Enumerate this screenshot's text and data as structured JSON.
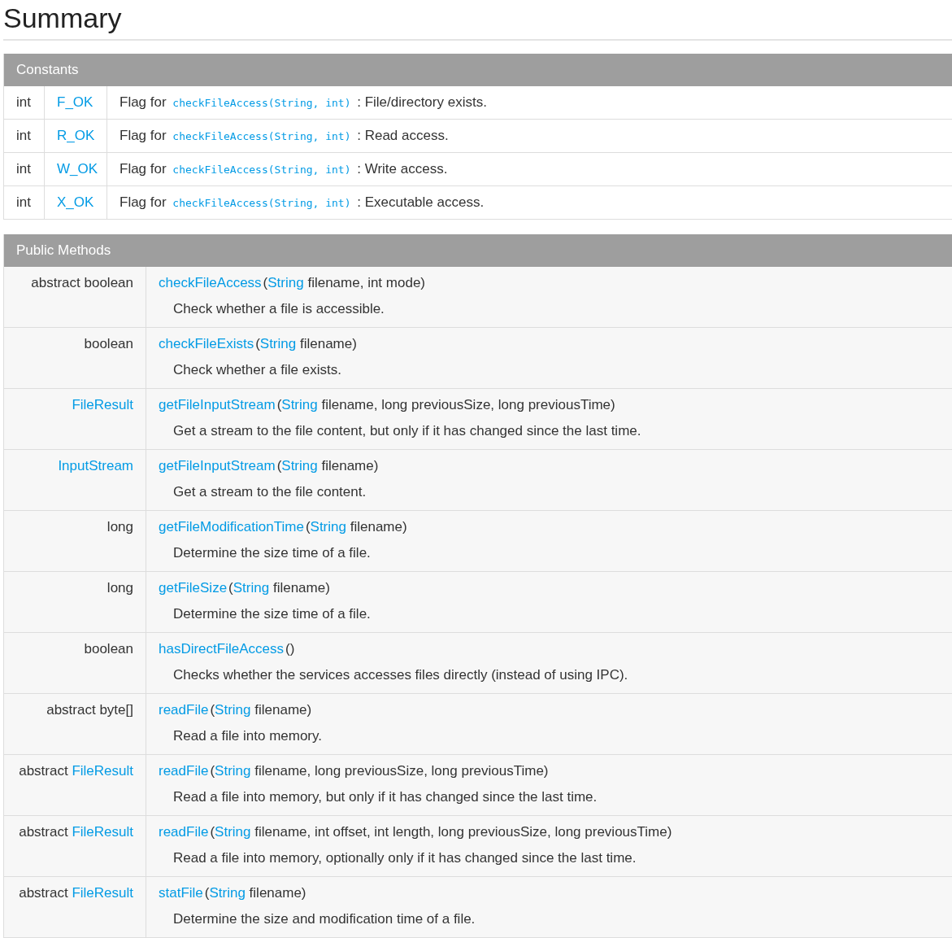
{
  "title": "Summary",
  "constants": {
    "heading": "Constants",
    "rows": [
      {
        "type": "int",
        "name": "F_OK",
        "prefix": "Flag for",
        "code": "checkFileAccess(String, int)",
        "suffix": ": File/directory exists."
      },
      {
        "type": "int",
        "name": "R_OK",
        "prefix": "Flag for",
        "code": "checkFileAccess(String, int)",
        "suffix": ": Read access."
      },
      {
        "type": "int",
        "name": "W_OK",
        "prefix": "Flag for",
        "code": "checkFileAccess(String, int)",
        "suffix": ": Write access."
      },
      {
        "type": "int",
        "name": "X_OK",
        "prefix": "Flag for",
        "code": "checkFileAccess(String, int)",
        "suffix": ": Executable access."
      }
    ]
  },
  "methods": {
    "heading": "Public Methods",
    "rows": [
      {
        "modifier": "abstract",
        "type": "boolean",
        "type_link": false,
        "name": "checkFileAccess",
        "params": [
          {
            "text": "(",
            "link": false
          },
          {
            "text": "String",
            "link": true
          },
          {
            "text": " filename, int mode)",
            "link": false
          }
        ],
        "description": "Check whether a file is accessible."
      },
      {
        "type": "boolean",
        "type_link": false,
        "name": "checkFileExists",
        "params": [
          {
            "text": "(",
            "link": false
          },
          {
            "text": "String",
            "link": true
          },
          {
            "text": " filename)",
            "link": false
          }
        ],
        "description": "Check whether a file exists."
      },
      {
        "type": "FileResult",
        "type_link": true,
        "name": "getFileInputStream",
        "params": [
          {
            "text": "(",
            "link": false
          },
          {
            "text": "String",
            "link": true
          },
          {
            "text": " filename, long previousSize, long previousTime)",
            "link": false
          }
        ],
        "description": "Get a stream to the file content, but only if it has changed since the last time."
      },
      {
        "type": "InputStream",
        "type_link": true,
        "name": "getFileInputStream",
        "params": [
          {
            "text": "(",
            "link": false
          },
          {
            "text": "String",
            "link": true
          },
          {
            "text": " filename)",
            "link": false
          }
        ],
        "description": "Get a stream to the file content."
      },
      {
        "type": "long",
        "type_link": false,
        "name": "getFileModificationTime",
        "params": [
          {
            "text": "(",
            "link": false
          },
          {
            "text": "String",
            "link": true
          },
          {
            "text": " filename)",
            "link": false
          }
        ],
        "description": "Determine the size time of a file."
      },
      {
        "type": "long",
        "type_link": false,
        "name": "getFileSize",
        "params": [
          {
            "text": "(",
            "link": false
          },
          {
            "text": "String",
            "link": true
          },
          {
            "text": " filename)",
            "link": false
          }
        ],
        "description": "Determine the size time of a file."
      },
      {
        "type": "boolean",
        "type_link": false,
        "name": "hasDirectFileAccess",
        "params": [
          {
            "text": "()",
            "link": false
          }
        ],
        "description": "Checks whether the services accesses files directly (instead of using IPC)."
      },
      {
        "modifier": "abstract",
        "type": "byte[]",
        "type_link": false,
        "name": "readFile",
        "params": [
          {
            "text": "(",
            "link": false
          },
          {
            "text": "String",
            "link": true
          },
          {
            "text": " filename)",
            "link": false
          }
        ],
        "description": "Read a file into memory."
      },
      {
        "modifier": "abstract",
        "type": "FileResult",
        "type_link": true,
        "name": "readFile",
        "params": [
          {
            "text": "(",
            "link": false
          },
          {
            "text": "String",
            "link": true
          },
          {
            "text": " filename, long previousSize, long previousTime)",
            "link": false
          }
        ],
        "description": "Read a file into memory, but only if it has changed since the last time."
      },
      {
        "modifier": "abstract",
        "type": "FileResult",
        "type_link": true,
        "name": "readFile",
        "params": [
          {
            "text": "(",
            "link": false
          },
          {
            "text": "String",
            "link": true
          },
          {
            "text": " filename, int offset, int length, long previousSize, long previousTime)",
            "link": false
          }
        ],
        "description": "Read a file into memory, optionally only if it has changed since the last time."
      },
      {
        "modifier": "abstract",
        "type": "FileResult",
        "type_link": true,
        "name": "statFile",
        "params": [
          {
            "text": "(",
            "link": false
          },
          {
            "text": "String",
            "link": true
          },
          {
            "text": " filename)",
            "link": false
          }
        ],
        "description": "Determine the size and modification time of a file."
      }
    ]
  }
}
